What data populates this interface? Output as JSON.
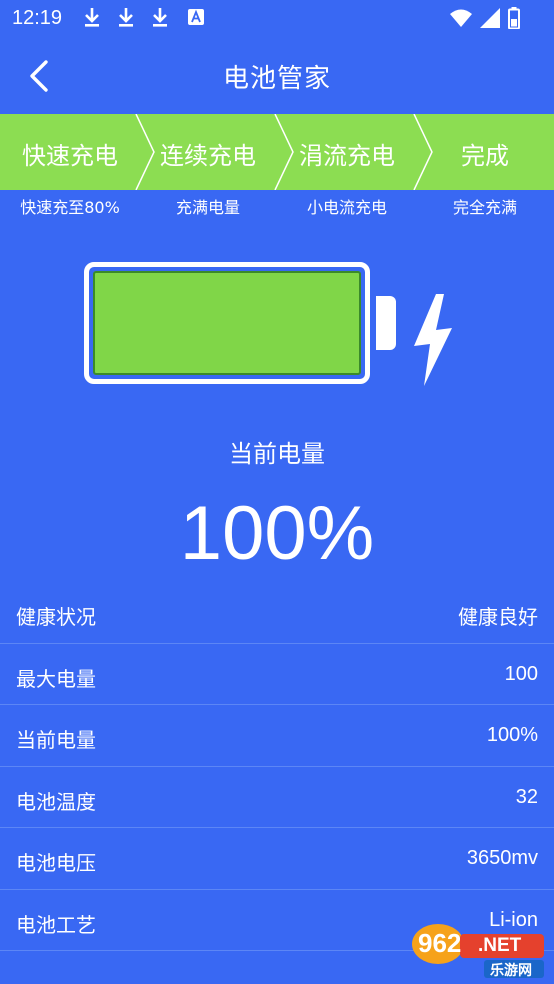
{
  "status_bar": {
    "time": "12:19"
  },
  "header": {
    "title": "电池管家"
  },
  "stepper": {
    "steps": [
      {
        "label": "快速充电",
        "desc": "快速充至80%"
      },
      {
        "label": "连续充电",
        "desc": "充满电量"
      },
      {
        "label": "涓流充电",
        "desc": "小电流充电"
      },
      {
        "label": "完成",
        "desc": "完全充满"
      }
    ],
    "active_color": "#8cdd52"
  },
  "battery": {
    "level_fraction": 1.0,
    "fill_color": "#80d648"
  },
  "current": {
    "label": "当前电量",
    "value": "100%"
  },
  "info": {
    "rows": [
      {
        "key": "健康状况",
        "value": "健康良好"
      },
      {
        "key": "最大电量",
        "value": "100"
      },
      {
        "key": "当前电量",
        "value": "100%"
      },
      {
        "key": "电池温度",
        "value": "32"
      },
      {
        "key": "电池电压",
        "value": "3650mv"
      },
      {
        "key": "电池工艺",
        "value": "Li-ion"
      }
    ]
  },
  "watermark": {
    "brand": "962",
    "suffix": ".NET",
    "sub": "乐游网"
  },
  "colors": {
    "background": "#3968f3",
    "divider": "#5c86f5"
  }
}
